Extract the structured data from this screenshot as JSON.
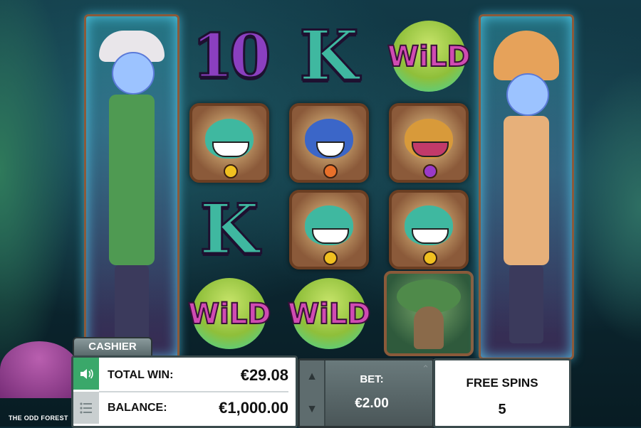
{
  "game_title": "THE ODD FOREST",
  "symbols": {
    "ten": "10",
    "king": "K",
    "wild": "WiLD"
  },
  "panel": {
    "cashier_label": "CASHIER",
    "total_win_label": "TOTAL WIN:",
    "total_win_value": "€29.08",
    "balance_label": "BALANCE:",
    "balance_value": "€1,000.00",
    "bet_label": "BET:",
    "bet_value": "€2.00",
    "free_spins_label": "FREE SPINS",
    "free_spins_value": "5"
  },
  "icons": {
    "sound": "speaker-icon",
    "menu": "menu-icon",
    "bet_up": "chevron-up-icon",
    "bet_down": "chevron-down-icon"
  },
  "colors": {
    "sound_button": "#3aa86a",
    "wild_text": "#d04bb2",
    "king_symbol": "#3fb8a0",
    "ten_symbol": "#8b3fc0"
  }
}
